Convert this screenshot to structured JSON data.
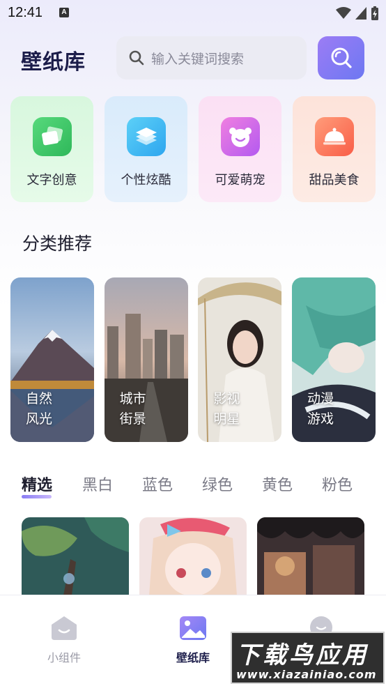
{
  "status_bar": {
    "time": "12:41",
    "notification_letter": "A"
  },
  "header": {
    "app_title": "壁纸库",
    "search_placeholder": "输入关键词搜索"
  },
  "quick_categories": [
    {
      "label": "文字创意",
      "icon": "cards-icon",
      "color": "#3ec96a"
    },
    {
      "label": "个性炫酷",
      "icon": "layers-icon",
      "color": "#3ab6f3"
    },
    {
      "label": "可爱萌宠",
      "icon": "bear-face-icon",
      "color": "#d66cf0"
    },
    {
      "label": "甜品美食",
      "icon": "cloche-icon",
      "color": "#fb6f4f"
    }
  ],
  "section_title": "分类推荐",
  "category_tiles": [
    {
      "line1": "自然",
      "line2": "风光"
    },
    {
      "line1": "城市",
      "line2": "街景"
    },
    {
      "line1": "影视",
      "line2": "明星"
    },
    {
      "line1": "动漫",
      "line2": "游戏"
    }
  ],
  "color_tabs": [
    "精选",
    "黑白",
    "蓝色",
    "绿色",
    "黄色",
    "粉色"
  ],
  "active_tab": "精选",
  "bottom_nav": [
    {
      "label": "小组件",
      "icon": "widget-face-icon",
      "active": false
    },
    {
      "label": "壁纸库",
      "icon": "gallery-icon",
      "active": true
    },
    {
      "label": "",
      "icon": "profile-face-icon",
      "active": false
    }
  ],
  "watermark": {
    "text": "下载鸟应用",
    "url": "www.xiazainiao.com"
  }
}
